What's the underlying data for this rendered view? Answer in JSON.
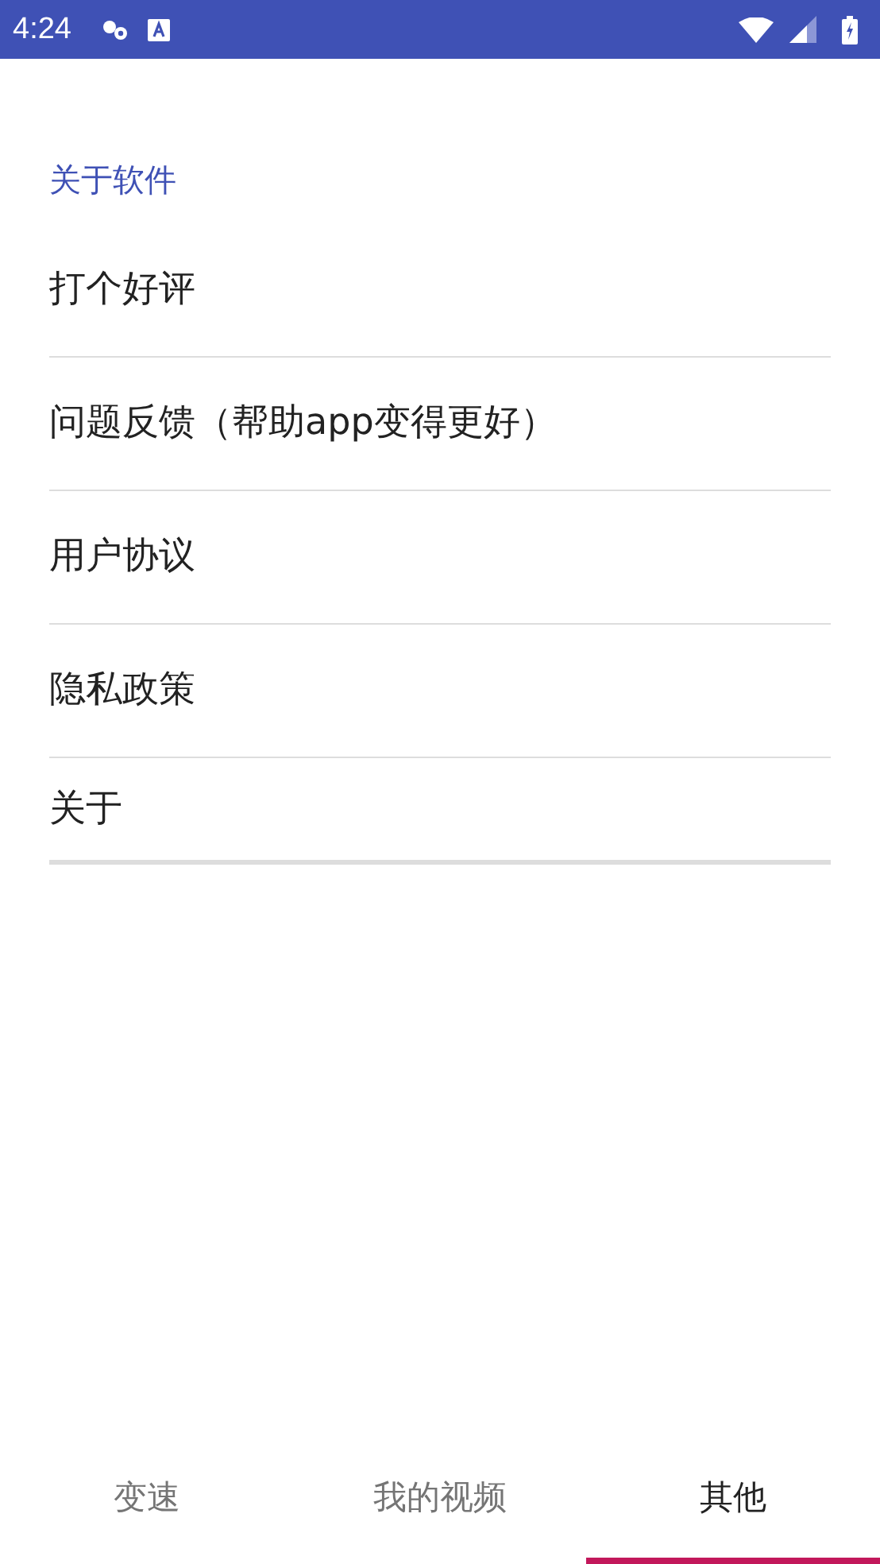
{
  "status_bar": {
    "time": "4:24"
  },
  "section": {
    "title": "关于软件"
  },
  "items": [
    {
      "label": "打个好评"
    },
    {
      "label": "问题反馈（帮助app变得更好）"
    },
    {
      "label": "用户协议"
    },
    {
      "label": "隐私政策"
    },
    {
      "label": "关于"
    }
  ],
  "tabs": [
    {
      "label": "变速",
      "selected": false
    },
    {
      "label": "我的视频",
      "selected": false
    },
    {
      "label": "其他",
      "selected": true
    }
  ]
}
